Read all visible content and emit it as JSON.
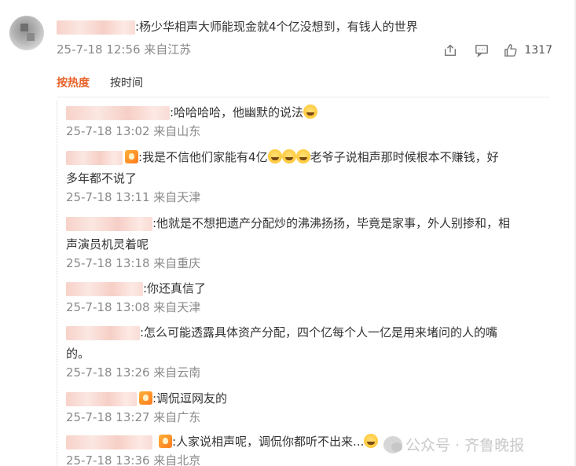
{
  "main_comment": {
    "text": ":杨少华相声大师能现金就4个亿没想到，有钱人的世界",
    "meta": "25-7-18 12:56 来自江苏",
    "like_count": "1317",
    "icons": {
      "share": "share-icon",
      "comment": "comment-icon",
      "like": "thumbs-up-icon"
    }
  },
  "sort_tabs": {
    "hot": "按热度",
    "time": "按时间"
  },
  "replies": [
    {
      "text": ":哈哈哈哈，他幽默的说法",
      "meta": "25-7-18 13:02 来自山东"
    },
    {
      "text_a": ":我是不信他们家能有4亿",
      "text_b": "老爷子说相声那时候根本不赚钱，好",
      "text_c": "多年都不说了",
      "meta": "25-7-18 13:11 来自天津"
    },
    {
      "text": ":他就是不想把遗产分配炒的沸沸扬扬，毕竟是家事，外人别掺和，相",
      "text_cont": "声演员机灵着呢",
      "meta": "25-7-18 13:18 来自重庆"
    },
    {
      "text": ":你还真信了",
      "meta": "25-7-18 13:08 来自天津"
    },
    {
      "text": ":怎么可能透露具体资产分配，四个亿每个人一亿是用来堵问的人的嘴",
      "text_cont": "的。",
      "meta": "25-7-18 13:26 来自云南"
    },
    {
      "text": ":调侃逗网友的",
      "meta": "25-7-18 13:27 来自广东"
    },
    {
      "text": ":人家说相声呢，调侃你都听不出来...",
      "meta": "25-7-18 13:36 来自北京"
    }
  ],
  "watermark": {
    "text": "公众号 · 齐鲁晚报"
  }
}
